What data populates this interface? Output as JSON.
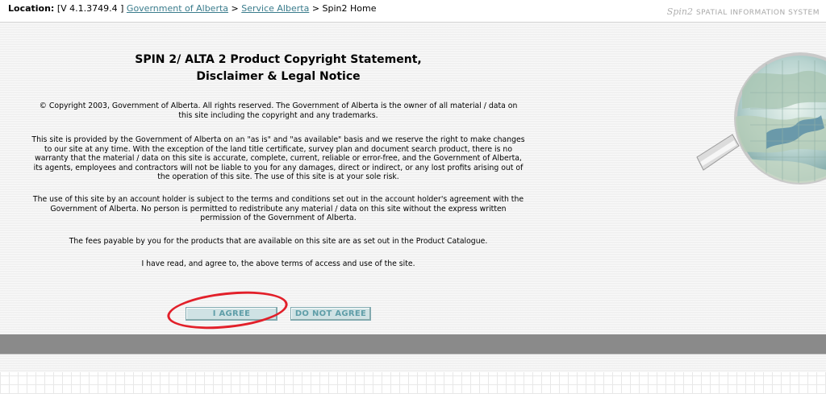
{
  "header": {
    "location_label": "Location:",
    "version": "[V 4.1.3749.4 ]",
    "breadcrumbs": [
      {
        "label": "Government of Alberta"
      },
      {
        "label": "Service Alberta"
      }
    ],
    "separator": ">",
    "current": "Spin2 Home",
    "brand_logo": "Spin2",
    "brand_tagline": "SPATIAL INFORMATION SYSTEM"
  },
  "main": {
    "title_line1": "SPIN 2/ ALTA 2 Product Copyright Statement,",
    "title_line2": "Disclaimer & Legal Notice",
    "paragraphs": [
      [
        "© Copyright 2003, Government of Alberta.  All rights reserved.  The Government of Alberta is the owner of all material / data on",
        "this site including the copyright and any trademarks."
      ],
      [
        "This site is provided by the Government of Alberta on an \"as is\" and \"as available\" basis and we reserve the right to make changes",
        "to our site at any time.  With the exception of the land title certificate, survey plan and document search product, there is no",
        "warranty that the material / data on this site is accurate, complete, current, reliable or error-free, and the Government of Alberta,",
        "its agents, employees and contractors will not be liable to you for any damages, direct or indirect, or any lost profits arising out of",
        "the operation of this site. The use of this site is at your sole risk."
      ],
      [
        "The use of this site by an account holder is subject to the terms and conditions set out in the account holder's agreement with the",
        "Government of Alberta.  No person is permitted to redistribute any material / data on this site without the express written",
        "permission of the Government of Alberta."
      ],
      [
        "The fees payable by you for the products that are available on this site are as set out in the Product Catalogue."
      ],
      [
        "I have read, and agree to, the above terms of access and use of the site."
      ]
    ]
  },
  "buttons": {
    "agree": "I AGREE",
    "disagree": "DO NOT AGREE"
  },
  "colors": {
    "link": "#3a7c8c",
    "button_text": "#5f9ea8",
    "highlight_ring": "#e2202a",
    "footer_band": "#8a8a8a"
  }
}
